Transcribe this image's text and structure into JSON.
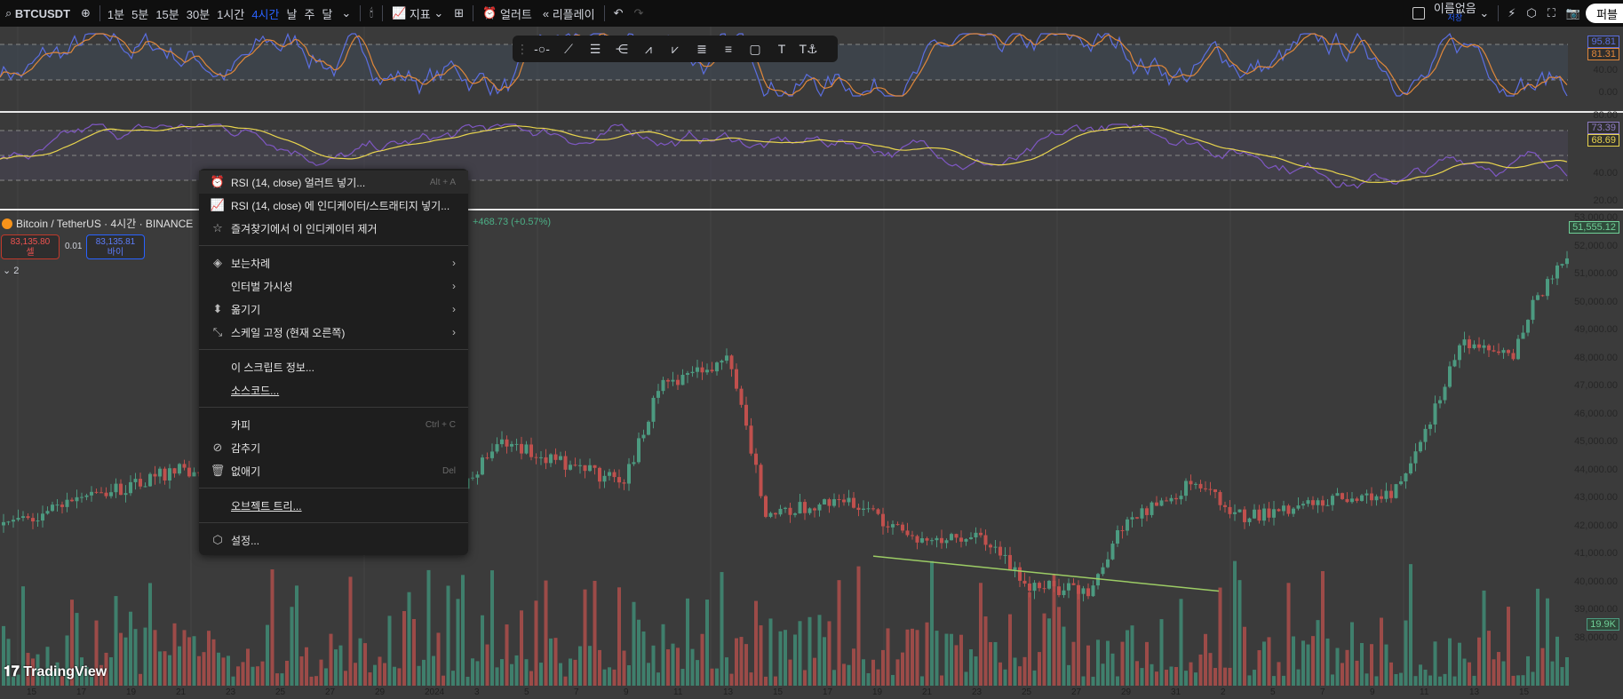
{
  "topbar": {
    "symbol": "BTCUSDT",
    "intervals": [
      "1분",
      "5분",
      "15분",
      "30분",
      "1시간",
      "4시간",
      "날",
      "주",
      "달"
    ],
    "active_interval": "4시간",
    "indicators": "지표",
    "alert": "얼러트",
    "replay": "리플레이",
    "layout_name": "이름없음",
    "layout_saved": "저장",
    "publish": "퍼블"
  },
  "stoch": {
    "k": "95.81",
    "d": "81.31",
    "axis": [
      "40.00",
      "0.00"
    ],
    "k_color": "#5b6ee1",
    "d_color": "#e0873a"
  },
  "rsi": {
    "rsi": "73.39",
    "ma": "68.69",
    "axis": [
      "80.00",
      "40.00",
      "20.00"
    ],
    "rsi_color": "#7e57c2",
    "ma_color": "#e8d44d"
  },
  "legend": {
    "title": "Bitcoin / TetherUS · 4시간 · BINANCE",
    "change": "+468.73 (+0.57%)",
    "sell_price": "83,135.80",
    "sell_label": "셀",
    "spread": "0.01",
    "buy_price": "83,135.81",
    "buy_label": "바이",
    "collapse": "2"
  },
  "price_axis": [
    "53,000.00",
    "52,000.00",
    "51,000.00",
    "50,000.00",
    "49,000.00",
    "48,000.00",
    "47,000.00",
    "46,000.00",
    "45,000.00",
    "44,000.00",
    "43,000.00",
    "42,000.00",
    "41,000.00",
    "40,000.00",
    "39,000.00",
    "38,000.00"
  ],
  "last_price": "51,555.12",
  "volume_tag": "19.9K",
  "time_axis": [
    "15",
    "17",
    "19",
    "21",
    "23",
    "25",
    "27",
    "29",
    "2024",
    "3",
    "5",
    "7",
    "9",
    "11",
    "13",
    "15",
    "17",
    "19",
    "21",
    "23",
    "25",
    "27",
    "29",
    "31",
    "2",
    "5",
    "7",
    "9",
    "11",
    "13",
    "15"
  ],
  "menu": {
    "items": [
      {
        "label": "RSI (14, close) 얼러트 넣기...",
        "shortcut": "Alt + A"
      },
      {
        "label": "RSI (14, close) 에 인디케이터/스트래티지 넣기..."
      },
      {
        "label": "즐겨찾기에서 이 인디케이터 제거"
      },
      {
        "label": "보는차례"
      },
      {
        "label": "인터벌 가시성"
      },
      {
        "label": "옮기기"
      },
      {
        "label": "스케일 고정 (현재 오른쪽)"
      },
      {
        "label": "이 스크립트 정보..."
      },
      {
        "label": "소스코드..."
      },
      {
        "label": "카피",
        "shortcut": "Ctrl + C"
      },
      {
        "label": "감추기"
      },
      {
        "label": "없애기",
        "shortcut": "Del"
      },
      {
        "label": "오브젝트 트리..."
      },
      {
        "label": "설정..."
      }
    ]
  },
  "logo": "TradingView"
}
